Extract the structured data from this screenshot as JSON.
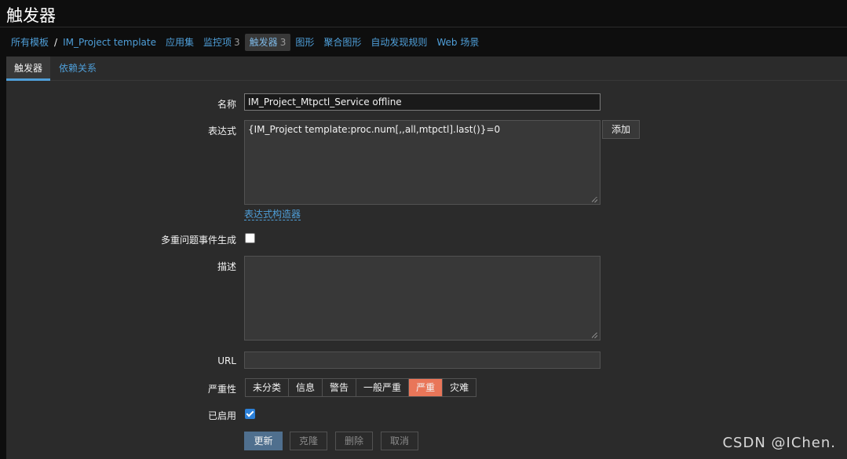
{
  "page": {
    "title": "触发器"
  },
  "breadcrumb": [
    {
      "label": "所有模板"
    },
    {
      "label": "IM_Project template"
    },
    {
      "label": "应用集"
    },
    {
      "label": "监控项",
      "count": "3"
    },
    {
      "label": "触发器",
      "count": "3",
      "active": true
    },
    {
      "label": "图形"
    },
    {
      "label": "聚合图形"
    },
    {
      "label": "自动发现规则"
    },
    {
      "label": "Web 场景"
    }
  ],
  "tabs": {
    "trigger": "触发器",
    "dependencies": "依赖关系"
  },
  "form": {
    "name_label": "名称",
    "name_value": "IM_Project_Mtpctl_Service offline",
    "expression_label": "表达式",
    "expression_value": "{IM_Project template:proc.num[,,all,mtpctl].last()}=0",
    "add_button": "添加",
    "expression_builder_link": "表达式构造器",
    "multiple_events_label": "多重问题事件生成",
    "multiple_events_checked": false,
    "description_label": "描述",
    "description_value": "",
    "url_label": "URL",
    "url_value": "",
    "severity_label": "严重性",
    "severity_options": [
      "未分类",
      "信息",
      "警告",
      "一般严重",
      "严重",
      "灾难"
    ],
    "severity_selected": "严重",
    "enabled_label": "已启用",
    "enabled_checked": true
  },
  "actions": {
    "update": "更新",
    "clone": "克隆",
    "delete": "删除",
    "cancel": "取消"
  },
  "colors": {
    "accent": "#4f9fd9",
    "severity_high": "#e97659",
    "primary_button": "#4f6f8e"
  },
  "watermark": "CSDN @IChen."
}
